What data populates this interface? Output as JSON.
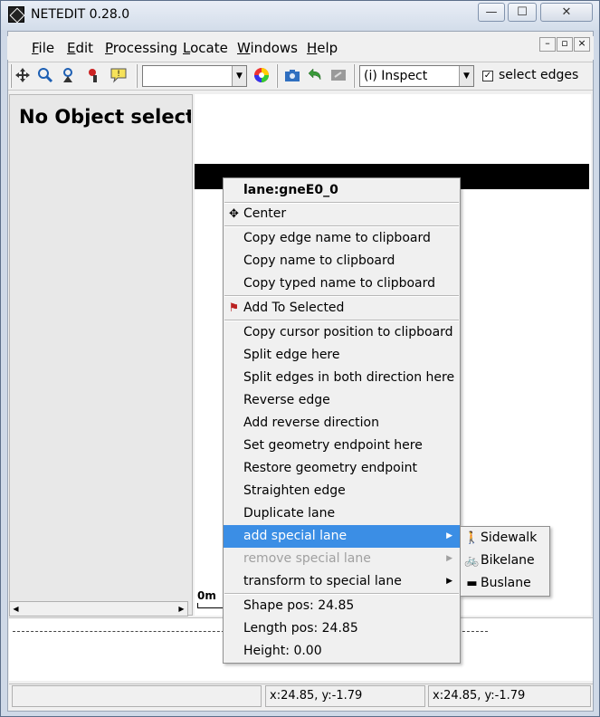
{
  "window": {
    "title": "NETEDIT 0.28.0",
    "min": "—",
    "max": "☐",
    "close": "✕"
  },
  "menubar": {
    "items": [
      {
        "pre": "",
        "ul": "F",
        "post": "ile"
      },
      {
        "pre": "",
        "ul": "E",
        "post": "dit"
      },
      {
        "pre": "",
        "ul": "P",
        "post": "rocessing"
      },
      {
        "pre": "",
        "ul": "L",
        "post": "ocate"
      },
      {
        "pre": "",
        "ul": "W",
        "post": "indows"
      },
      {
        "pre": "",
        "ul": "H",
        "post": "elp"
      }
    ],
    "mdi": [
      "–",
      "▫",
      "×"
    ]
  },
  "toolbar": {
    "combo1_value": "",
    "mode_value": "(i) Inspect",
    "select_edges_label": "select edges",
    "select_edges_checked": true,
    "icons": [
      "center-icon",
      "locate-junction-icon",
      "locate-edge-icon",
      "locate-tls-icon",
      "tooltip-icon",
      "color-wheel-icon",
      "screenshot-icon",
      "undo-icon",
      "redo-icon"
    ]
  },
  "left_panel": {
    "heading": "No Object selected"
  },
  "canvas": {
    "scale_label": "0m"
  },
  "popup": {
    "header": "lane:gneE0_0",
    "items": [
      {
        "label": "Center",
        "icon": "✥"
      },
      {
        "label": "Copy edge name to clipboard"
      },
      {
        "label": "Copy name to clipboard"
      },
      {
        "label": "Copy typed name to clipboard"
      },
      {
        "label": "Add To Selected",
        "icon": "⚑"
      },
      {
        "label": "Copy cursor position to clipboard"
      },
      {
        "label": "Split edge here"
      },
      {
        "label": "Split edges in both direction here"
      },
      {
        "label": "Reverse edge"
      },
      {
        "label": "Add reverse direction"
      },
      {
        "label": "Set geometry endpoint here"
      },
      {
        "label": "Restore geometry endpoint"
      },
      {
        "label": "Straighten edge"
      },
      {
        "label": "Duplicate lane"
      },
      {
        "label": "add special lane",
        "highlighted": true,
        "submenu": true
      },
      {
        "label": "remove special lane",
        "disabled": true,
        "submenu": true
      },
      {
        "label": "transform to special lane",
        "submenu": true
      },
      {
        "label": "Shape pos: 24.85"
      },
      {
        "label": "Length pos: 24.85"
      },
      {
        "label": "Height: 0.00"
      }
    ]
  },
  "submenu": {
    "items": [
      {
        "label": "Sidewalk",
        "icon": "🚶"
      },
      {
        "label": "Bikelane",
        "icon": "🚲"
      },
      {
        "label": "Buslane",
        "icon": "▬"
      }
    ]
  },
  "status": {
    "cell1": "",
    "cell2": "x:24.85, y:-1.79",
    "cell3": "x:24.85, y:-1.79"
  },
  "colors": {
    "highlight": "#3b8ee5",
    "lane": "#000000"
  }
}
